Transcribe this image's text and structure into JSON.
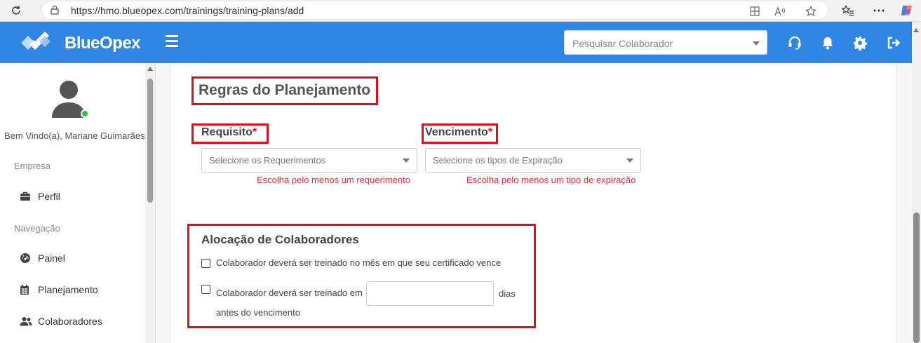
{
  "browser": {
    "url": "https://hmo.blueopex.com/trainings/training-plans/add",
    "icons": [
      "refresh-icon",
      "lock-icon",
      "grid-icon",
      "read-aloud-icon",
      "favorite-star-icon",
      "favorites-icon",
      "more-icon",
      "copilot-icon"
    ]
  },
  "header": {
    "brand": "BlueOpex",
    "search_placeholder": "Pesquisar Colaborador",
    "accent_color": "#2f86e4",
    "icons": [
      "headset-icon",
      "bell-icon",
      "gear-icon",
      "logout-icon"
    ]
  },
  "sidebar": {
    "welcome": "Bem Vindo(a), Mariane Guimarães",
    "section_company": "Empresa",
    "section_navigation": "Navegação",
    "items": [
      {
        "label": "Perfil",
        "icon": "briefcase-icon"
      },
      {
        "label": "Painel",
        "icon": "dashboard-icon"
      },
      {
        "label": "Planejamento",
        "icon": "calendar-icon"
      },
      {
        "label": "Colaboradores",
        "icon": "users-icon"
      }
    ]
  },
  "form": {
    "title": "Regras do Planejamento",
    "requisito": {
      "label": "Requisito",
      "required_mark": "*",
      "placeholder": "Selecione os Requerimentos",
      "error": "Escolha pelo menos um requerimento"
    },
    "vencimento": {
      "label": "Vencimento",
      "required_mark": "*",
      "placeholder": "Selecione os tipos de Expiração",
      "error": "Escolha pelo menos um tipo de expiração"
    },
    "allocation": {
      "title": "Alocação de Colaboradores",
      "option1": "Colaborador deverá ser treinado no mês em que seu certificado vence",
      "option2_prefix": "Colaborador deverá ser treinado em",
      "option2_suffix": "dias",
      "option2_line2": "antes do vencimento",
      "days_value": ""
    }
  }
}
